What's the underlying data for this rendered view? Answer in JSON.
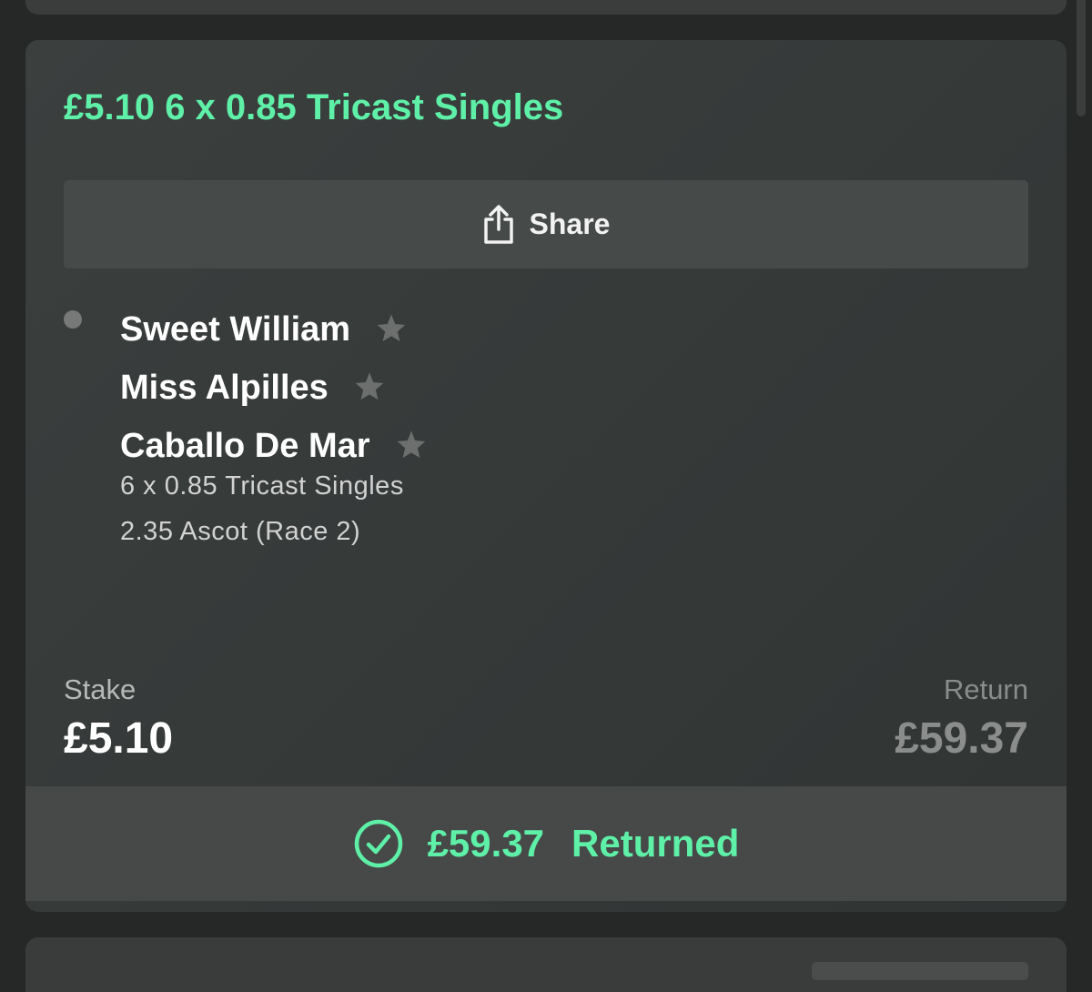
{
  "bet": {
    "title": "£5.10 6 x 0.85 Tricast Singles",
    "share_label": "Share",
    "selections": [
      {
        "name": "Sweet William"
      },
      {
        "name": "Miss Alpilles"
      },
      {
        "name": "Caballo De Mar"
      }
    ],
    "bet_type": "6 x 0.85 Tricast Singles",
    "race": "2.35 Ascot (Race 2)",
    "stake_label": "Stake",
    "stake_value": "£5.10",
    "return_label": "Return",
    "return_value": "£59.37",
    "returned_amount": "£59.37",
    "returned_label": "Returned"
  },
  "colors": {
    "accent": "#5ff0a8",
    "card_bg": "#363a39",
    "page_bg": "#262827",
    "status_bar_bg": "#464948"
  },
  "icons": {
    "share": "share-icon",
    "star": "star-icon",
    "check": "check-circle-icon"
  }
}
